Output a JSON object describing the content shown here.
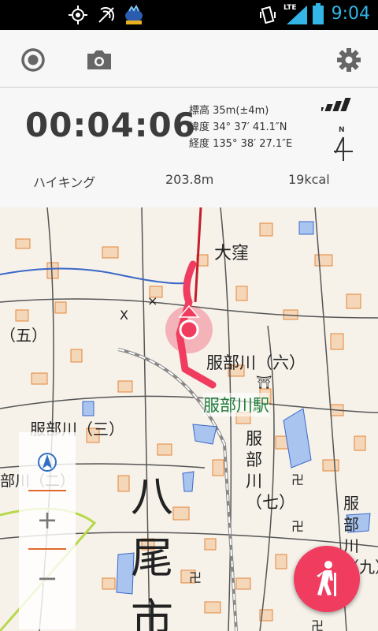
{
  "status": {
    "time": "9:04",
    "network": "LTE"
  },
  "toolbar": {
    "record_icon": "record-icon",
    "camera_icon": "camera-icon",
    "settings_icon": "gear-icon"
  },
  "tracker": {
    "elapsed": "00:04:06",
    "altitude": "標高 35m(±4m)",
    "latitude": "緯度 34° 37′ 41.1″N",
    "longitude": "経度 135° 38′ 27.1″E",
    "compass_label": "N"
  },
  "stats": {
    "activity": "ハイキング",
    "distance": "203.8m",
    "calories": "19kcal"
  },
  "map": {
    "labels": {
      "okubo": "大窪",
      "go": "（五）",
      "hattori_roku": "服部川（六）",
      "station": "服部川駅",
      "hattori_san": "服部川（三）",
      "hattori_ni": "部川（二）",
      "hattori_nana": "服部川（七）",
      "yao": "八尾市",
      "hattori_right": "服部川（九）"
    },
    "accent": "#f03c5f"
  },
  "zoom": {
    "plus": "+",
    "minus": "−"
  }
}
